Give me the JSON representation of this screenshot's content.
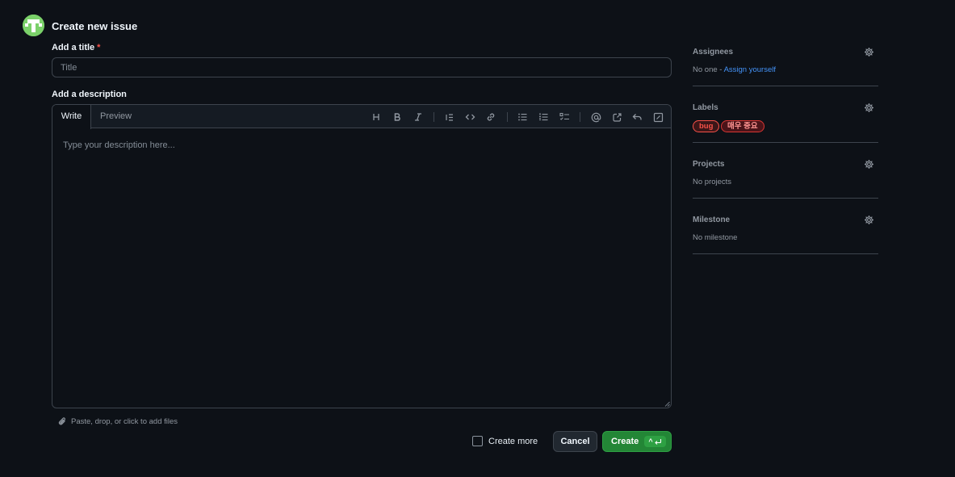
{
  "header": {
    "title": "Create new issue"
  },
  "title_field": {
    "label": "Add a title",
    "required_mark": "*",
    "placeholder": "Title",
    "value": ""
  },
  "description": {
    "label": "Add a description",
    "tabs": [
      {
        "label": "Write",
        "active": true
      },
      {
        "label": "Preview",
        "active": false
      }
    ],
    "placeholder": "Type your description here...",
    "toolbar_icons": [
      "heading-icon",
      "bold-icon",
      "italic-icon",
      "quote-icon",
      "code-icon",
      "link-icon",
      "unordered-list-icon",
      "ordered-list-icon",
      "task-list-icon",
      "mention-icon",
      "reference-icon",
      "undo-icon",
      "saved-replies-icon"
    ]
  },
  "attach": {
    "label": "Paste, drop, or click to add files"
  },
  "actions": {
    "create_more_label": "Create more",
    "create_more_checked": false,
    "cancel_label": "Cancel",
    "create_label": "Create",
    "create_shortcut": "^"
  },
  "sidebar": {
    "assignees": {
      "title": "Assignees",
      "empty": "No one - ",
      "link": "Assign yourself"
    },
    "labels": {
      "title": "Labels",
      "items": [
        {
          "name": "bug",
          "color": "#f85149",
          "bg": "#3c1618"
        },
        {
          "name": "매우 중요",
          "color": "#ff9492",
          "bg": "#4a1419"
        }
      ]
    },
    "projects": {
      "title": "Projects",
      "empty": "No projects"
    },
    "milestone": {
      "title": "Milestone",
      "empty": "No milestone"
    }
  },
  "colors": {
    "background": "#0d1117",
    "border": "#3d444d",
    "accent_link": "#4493f8",
    "create_green": "#238636"
  }
}
